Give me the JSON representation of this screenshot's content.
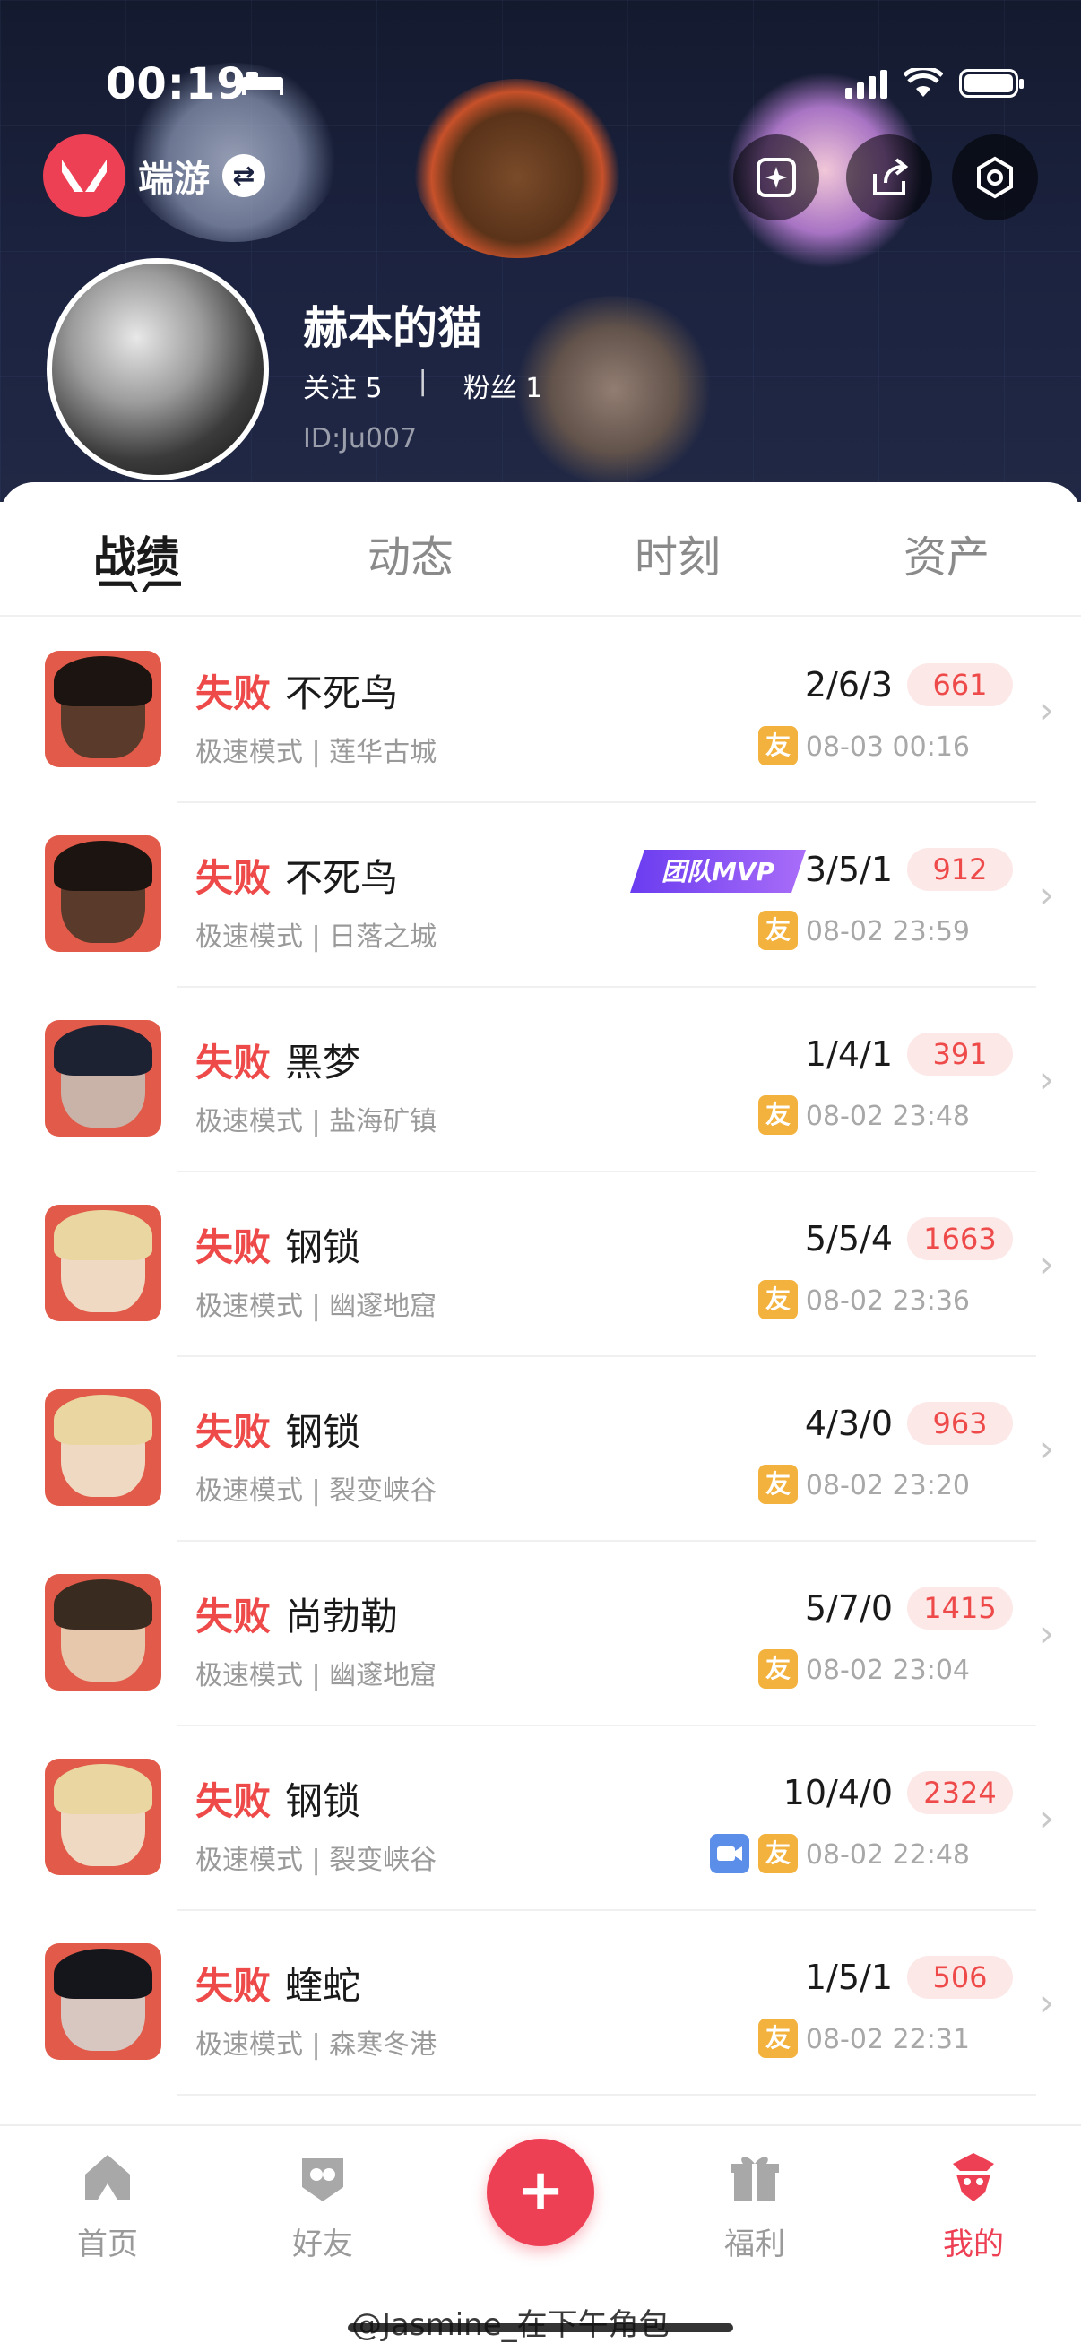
{
  "status_bar": {
    "time": "00:19"
  },
  "header": {
    "game_name": "端游",
    "swap_icon": "swap-icon",
    "top_buttons": [
      "sparkle-icon",
      "share-icon",
      "settings-hex-icon"
    ]
  },
  "profile": {
    "username": "赫本的猫",
    "following_label": "关注 5",
    "divider": "|",
    "fans_label": "粉丝 1",
    "id_label": "ID:Ju007"
  },
  "tabs": [
    {
      "label": "战绩",
      "active": true
    },
    {
      "label": "动态",
      "active": false
    },
    {
      "label": "时刻",
      "active": false
    },
    {
      "label": "资产",
      "active": false
    }
  ],
  "matches": [
    {
      "result": "失败",
      "agent": "不死鸟",
      "mode": "极速模式 | 莲华古城",
      "kda": "2/6/3",
      "score": "661",
      "time": "08-03 00:16",
      "friend": "友",
      "mvp": "",
      "video": false,
      "portrait": "phoenix"
    },
    {
      "result": "失败",
      "agent": "不死鸟",
      "mode": "极速模式 | 日落之城",
      "kda": "3/5/1",
      "score": "912",
      "time": "08-02 23:59",
      "friend": "友",
      "mvp": "团队MVP",
      "video": false,
      "portrait": "phoenix"
    },
    {
      "result": "失败",
      "agent": "黑梦",
      "mode": "极速模式 | 盐海矿镇",
      "kda": "1/4/1",
      "score": "391",
      "time": "08-02 23:48",
      "friend": "友",
      "mvp": "",
      "video": false,
      "portrait": "fade"
    },
    {
      "result": "失败",
      "agent": "钢锁",
      "mode": "极速模式 | 幽邃地窟",
      "kda": "5/5/4",
      "score": "1663",
      "time": "08-02 23:36",
      "friend": "友",
      "mvp": "",
      "video": false,
      "portrait": "deadlock"
    },
    {
      "result": "失败",
      "agent": "钢锁",
      "mode": "极速模式 | 裂变峡谷",
      "kda": "4/3/0",
      "score": "963",
      "time": "08-02 23:20",
      "friend": "友",
      "mvp": "",
      "video": false,
      "portrait": "deadlock"
    },
    {
      "result": "失败",
      "agent": "尚勃勒",
      "mode": "极速模式 | 幽邃地窟",
      "kda": "5/7/0",
      "score": "1415",
      "time": "08-02 23:04",
      "friend": "友",
      "mvp": "",
      "video": false,
      "portrait": "chamber"
    },
    {
      "result": "失败",
      "agent": "钢锁",
      "mode": "极速模式 | 裂变峡谷",
      "kda": "10/4/0",
      "score": "2324",
      "time": "08-02 22:48",
      "friend": "友",
      "mvp": "",
      "video": true,
      "portrait": "deadlock"
    },
    {
      "result": "失败",
      "agent": "蝰蛇",
      "mode": "极速模式 | 森寒冬港",
      "kda": "1/5/1",
      "score": "506",
      "time": "08-02 22:31",
      "friend": "友",
      "mvp": "",
      "video": false,
      "portrait": "viper"
    }
  ],
  "bottom_nav": [
    {
      "label": "首页",
      "icon": "home-icon",
      "active": false
    },
    {
      "label": "好友",
      "icon": "friends-icon",
      "active": false
    },
    {
      "label": "福利",
      "icon": "gift-icon",
      "active": false
    },
    {
      "label": "我的",
      "icon": "profile-icon",
      "active": true
    }
  ],
  "fab": {
    "label": "+"
  },
  "watermark": "@Jasmine_在下午角包",
  "colors": {
    "accent": "#ee4054",
    "loss": "#ee4a4a",
    "friend_badge": "#f3b23d",
    "header_bg": "#1c2340"
  }
}
